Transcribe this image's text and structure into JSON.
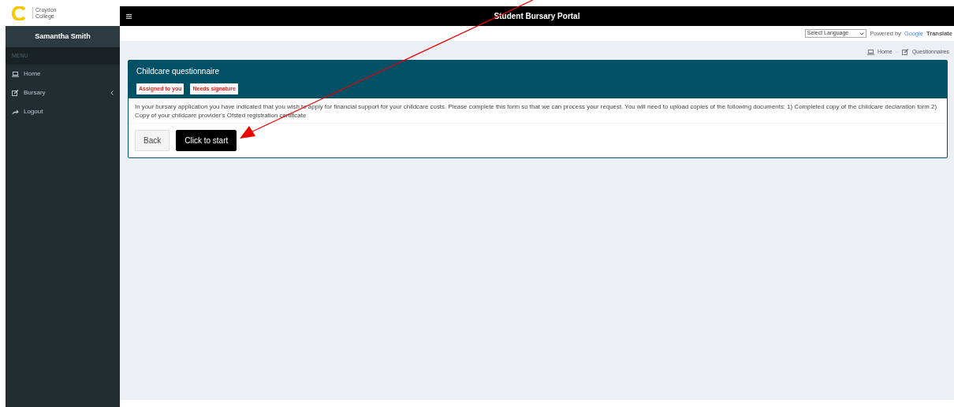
{
  "logo": {
    "name_line_1": "Croydon",
    "name_line_2": "College"
  },
  "topbar": {
    "title": "Student Bursary Portal"
  },
  "sidebar": {
    "user": "Samantha Smith",
    "header": "MENU",
    "items": [
      {
        "label": "Home",
        "has_submenu": false
      },
      {
        "label": "Bursary",
        "has_submenu": true
      },
      {
        "label": "Logout",
        "has_submenu": false
      }
    ]
  },
  "translate": {
    "select": "Select Language",
    "powered_by": "Powered by",
    "google": "Google",
    "translate": "Translate"
  },
  "breadcrumb": [
    {
      "label": "Home"
    },
    {
      "label": "Questionnaires"
    }
  ],
  "breadcrumb_separator": "-",
  "card": {
    "title": "Childcare questionnaire",
    "badges": [
      "Assigned to you",
      "Needs signature"
    ],
    "text": "In your bursary application you have indicated that you wish to apply for financial support for your childcare costs. Please complete this form so that we can process your request. You will need to upload copies of the following documents: 1) Completed copy of the childcare declaration form 2) Copy of your childcare provider's Ofsted registration certificate",
    "buttons": [
      {
        "label": "Back",
        "kind": "secondary"
      },
      {
        "label": "Click to start",
        "kind": "primary"
      }
    ]
  }
}
